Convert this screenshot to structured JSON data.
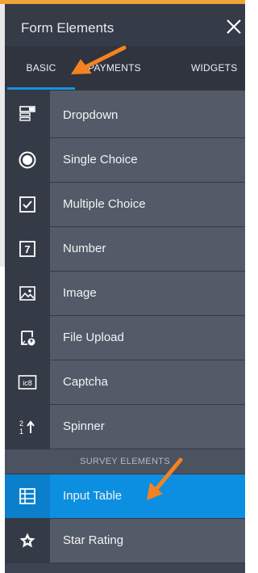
{
  "header": {
    "title": "Form Elements"
  },
  "tabs": [
    {
      "label": "BASIC"
    },
    {
      "label": "PAYMENTS"
    },
    {
      "label": "WIDGETS"
    }
  ],
  "items": [
    {
      "label": "Dropdown",
      "icon": "dropdown-icon"
    },
    {
      "label": "Single Choice",
      "icon": "radio-icon"
    },
    {
      "label": "Multiple Choice",
      "icon": "checkbox-icon"
    },
    {
      "label": "Number",
      "icon": "number-icon"
    },
    {
      "label": "Image",
      "icon": "image-icon"
    },
    {
      "label": "File Upload",
      "icon": "file-upload-icon"
    },
    {
      "label": "Captcha",
      "icon": "captcha-icon"
    },
    {
      "label": "Spinner",
      "icon": "spinner-icon"
    }
  ],
  "section": {
    "label": "SURVEY ELEMENTS"
  },
  "survey_items": [
    {
      "label": "Input Table",
      "icon": "grid-table-icon",
      "active": true
    },
    {
      "label": "Star Rating",
      "icon": "star-icon"
    }
  ],
  "number_icon_glyph": "7",
  "captcha_icon_glyph": "ic8",
  "spinner_icon_glyph": "21",
  "colors": {
    "accent": "#f58220",
    "active": "#0d8fe1",
    "panel": "#3d4452"
  }
}
